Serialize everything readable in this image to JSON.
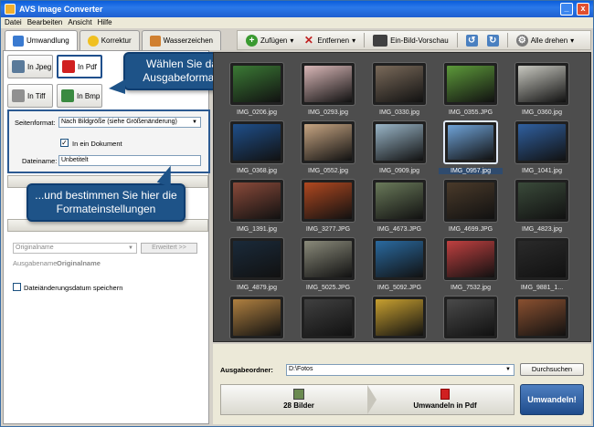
{
  "window": {
    "title": "AVS Image Converter",
    "minimize": "_",
    "close": "x"
  },
  "menu": [
    "Datei",
    "Bearbeiten",
    "Ansicht",
    "Hilfe"
  ],
  "tabs": [
    {
      "label": "Umwandlung",
      "icon": "convert-icon",
      "active": true
    },
    {
      "label": "Korrektur",
      "icon": "star-icon",
      "active": false
    },
    {
      "label": "Wasserzeichen",
      "icon": "watermark-icon",
      "active": false
    }
  ],
  "toolbar": {
    "add": "Zufügen",
    "remove": "Entfernen",
    "preview": "Ein-Bild-Vorschau",
    "rotate_all": "Alle drehen"
  },
  "formats": [
    {
      "label": "In Jpeg"
    },
    {
      "label": "In Pdf"
    },
    {
      "label": "In Tiff"
    },
    {
      "label": "In Bmp"
    }
  ],
  "settings": {
    "page_format_label": "Seitenformat:",
    "page_format_value": "Nach Bildgröße (siehe Größenänderung)",
    "one_document_label": "In ein Dokument",
    "one_document_checked": "✓",
    "file_name_label": "Dateiname:",
    "file_name_value": "Unbetitelt"
  },
  "rename": {
    "original_name": "Originalname",
    "extended": "Erweitert >>",
    "output_name_label": "Ausgabename:",
    "output_name_value": "Originalname"
  },
  "keep_date": "Dateiänderungsdatum speichern",
  "callouts": {
    "format": "Wählen Sie das Ausgabeformat...",
    "settings": "...und bestimmen Sie hier die Formateinstellungen"
  },
  "images": [
    {
      "name": "IMG_0206.jpg",
      "color": "#3b7a35"
    },
    {
      "name": "IMG_0293.jpg",
      "color": "#d9b7b7"
    },
    {
      "name": "IMG_0330.jpg",
      "color": "#7a6a5a"
    },
    {
      "name": "IMG_0355.JPG",
      "color": "#5d9a3a"
    },
    {
      "name": "IMG_0360.jpg",
      "color": "#c8c8c0"
    },
    {
      "name": "IMG_0368.jpg",
      "color": "#1f4f8a"
    },
    {
      "name": "IMG_0552.jpg",
      "color": "#c7a582"
    },
    {
      "name": "IMG_0909.jpg",
      "color": "#9ab6c8"
    },
    {
      "name": "IMG_0957.jpg",
      "color": "#6fa3d8",
      "selected": true
    },
    {
      "name": "IMG_1041.jpg",
      "color": "#3060a0"
    },
    {
      "name": "IMG_1391.jpg",
      "color": "#8a4a3a"
    },
    {
      "name": "IMG_3277.JPG",
      "color": "#b04820"
    },
    {
      "name": "IMG_4673.JPG",
      "color": "#6a7a5a"
    },
    {
      "name": "IMG_4699.JPG",
      "color": "#4a3a2a"
    },
    {
      "name": "IMG_4823.jpg",
      "color": "#3a4a3a"
    },
    {
      "name": "IMG_4879.jpg",
      "color": "#1a2a3a"
    },
    {
      "name": "IMG_5025.JPG",
      "color": "#8a8a7a"
    },
    {
      "name": "IMG_5092.JPG",
      "color": "#2a6aa0"
    },
    {
      "name": "IMG_7532.jpg",
      "color": "#c04040"
    },
    {
      "name": "IMG_9881_1...",
      "color": "#2a2a2a"
    },
    {
      "name": "",
      "color": "#b08040"
    },
    {
      "name": "",
      "color": "#404040"
    },
    {
      "name": "",
      "color": "#c8a030"
    },
    {
      "name": "",
      "color": "#4a4a4a"
    },
    {
      "name": "",
      "color": "#8a5030"
    }
  ],
  "output": {
    "folder_label": "Ausgabeordner:",
    "folder_value": "D:\\Fotos",
    "browse": "Durchsuchen",
    "count": "28 Bilder",
    "target": "Umwandeln in Pdf",
    "convert": "Umwandeln!"
  }
}
